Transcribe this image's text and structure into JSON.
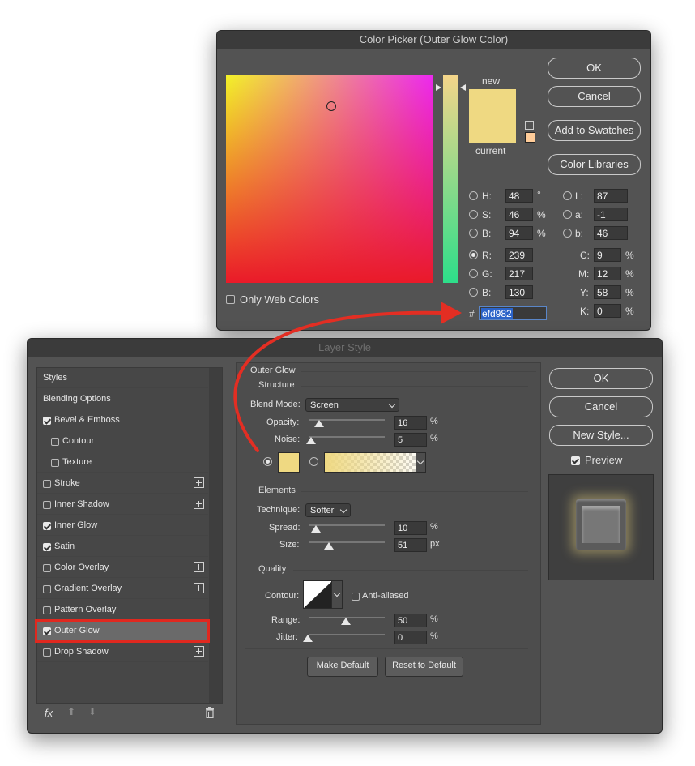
{
  "color_picker": {
    "title": "Color Picker (Outer Glow Color)",
    "buttons": {
      "ok": "OK",
      "cancel": "Cancel",
      "add_to_swatches": "Add to Swatches",
      "color_libraries": "Color Libraries"
    },
    "preview": {
      "new_label": "new",
      "current_label": "current",
      "new_color": "#efd982",
      "current_color": "#efd982"
    },
    "only_web_colors": "Only Web Colors",
    "hsb": {
      "h_label": "H:",
      "h": "48",
      "h_unit": "°",
      "s_label": "S:",
      "s": "46",
      "s_unit": "%",
      "b_label": "B:",
      "b": "94",
      "b_unit": "%"
    },
    "rgb": {
      "r_label": "R:",
      "r": "239",
      "g_label": "G:",
      "g": "217",
      "b_label": "B:",
      "b": "130"
    },
    "lab": {
      "l_label": "L:",
      "l": "87",
      "a_label": "a:",
      "a": "-1",
      "b_label": "b:",
      "b": "46"
    },
    "cmyk": {
      "c_label": "C:",
      "c": "9",
      "m_label": "M:",
      "m": "12",
      "y_label": "Y:",
      "y": "58",
      "k_label": "K:",
      "k": "0",
      "unit": "%"
    },
    "hex_label": "#",
    "hex": "efd982"
  },
  "layer_style": {
    "title": "Layer Style",
    "sidebar": [
      {
        "label": "Styles",
        "checkbox": false,
        "checked": false,
        "plus": false
      },
      {
        "label": "Blending Options",
        "checkbox": false,
        "checked": false,
        "plus": false
      },
      {
        "label": "Bevel & Emboss",
        "checkbox": true,
        "checked": true,
        "plus": false
      },
      {
        "label": "Contour",
        "checkbox": true,
        "checked": false,
        "plus": false,
        "indent": true
      },
      {
        "label": "Texture",
        "checkbox": true,
        "checked": false,
        "plus": false,
        "indent": true
      },
      {
        "label": "Stroke",
        "checkbox": true,
        "checked": false,
        "plus": true
      },
      {
        "label": "Inner Shadow",
        "checkbox": true,
        "checked": false,
        "plus": true
      },
      {
        "label": "Inner Glow",
        "checkbox": true,
        "checked": true,
        "plus": false
      },
      {
        "label": "Satin",
        "checkbox": true,
        "checked": true,
        "plus": false
      },
      {
        "label": "Color Overlay",
        "checkbox": true,
        "checked": false,
        "plus": true
      },
      {
        "label": "Gradient Overlay",
        "checkbox": true,
        "checked": false,
        "plus": true
      },
      {
        "label": "Pattern Overlay",
        "checkbox": true,
        "checked": false,
        "plus": false
      },
      {
        "label": "Outer Glow",
        "checkbox": true,
        "checked": true,
        "plus": false,
        "selected": true
      },
      {
        "label": "Drop Shadow",
        "checkbox": true,
        "checked": false,
        "plus": true
      }
    ],
    "bottom_icons": {
      "fx": "fx"
    },
    "panel": {
      "heading": "Outer Glow",
      "structure": {
        "label": "Structure",
        "blend_mode_label": "Blend Mode:",
        "blend_mode": "Screen",
        "opacity_label": "Opacity:",
        "opacity": "16",
        "opacity_unit": "%",
        "noise_label": "Noise:",
        "noise": "5",
        "noise_unit": "%",
        "glow_color": "#efd982"
      },
      "elements": {
        "label": "Elements",
        "technique_label": "Technique:",
        "technique": "Softer",
        "spread_label": "Spread:",
        "spread": "10",
        "spread_unit": "%",
        "size_label": "Size:",
        "size": "51",
        "size_unit": "px"
      },
      "quality": {
        "label": "Quality",
        "contour_label": "Contour:",
        "anti_aliased": "Anti-aliased",
        "range_label": "Range:",
        "range": "50",
        "range_unit": "%",
        "jitter_label": "Jitter:",
        "jitter": "0",
        "jitter_unit": "%"
      },
      "make_default": "Make Default",
      "reset_to_default": "Reset to Default"
    },
    "buttons": {
      "ok": "OK",
      "cancel": "Cancel",
      "new_style": "New Style...",
      "preview": "Preview"
    }
  }
}
